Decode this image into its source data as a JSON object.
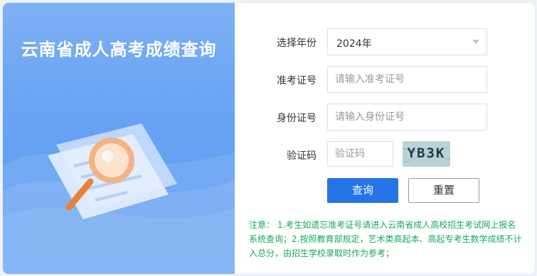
{
  "banner": {
    "title": "云南省成人高考成绩查询"
  },
  "form": {
    "year": {
      "label": "选择年份",
      "value": "2024年"
    },
    "exam_no": {
      "label": "准考证号",
      "placeholder": "请输入准考证号"
    },
    "id_no": {
      "label": "身份证号",
      "placeholder": "请输入身份证号"
    },
    "captcha": {
      "label": "验证码",
      "placeholder": "验证码",
      "image_text": "YB3K"
    },
    "query_label": "查询",
    "reset_label": "重置"
  },
  "notice": "注意： 1.考生如遗忘准考证号请进入云南省成人高校招生考试网上报名系统查询；2.按照教育部规定，艺术类高起本、高起专考生数学成绩不计入总分，由招生学校录取时作为参考；",
  "colors": {
    "primary": "#2474e6",
    "notice": "#1aa85a",
    "banner": "#6aa4f3"
  }
}
